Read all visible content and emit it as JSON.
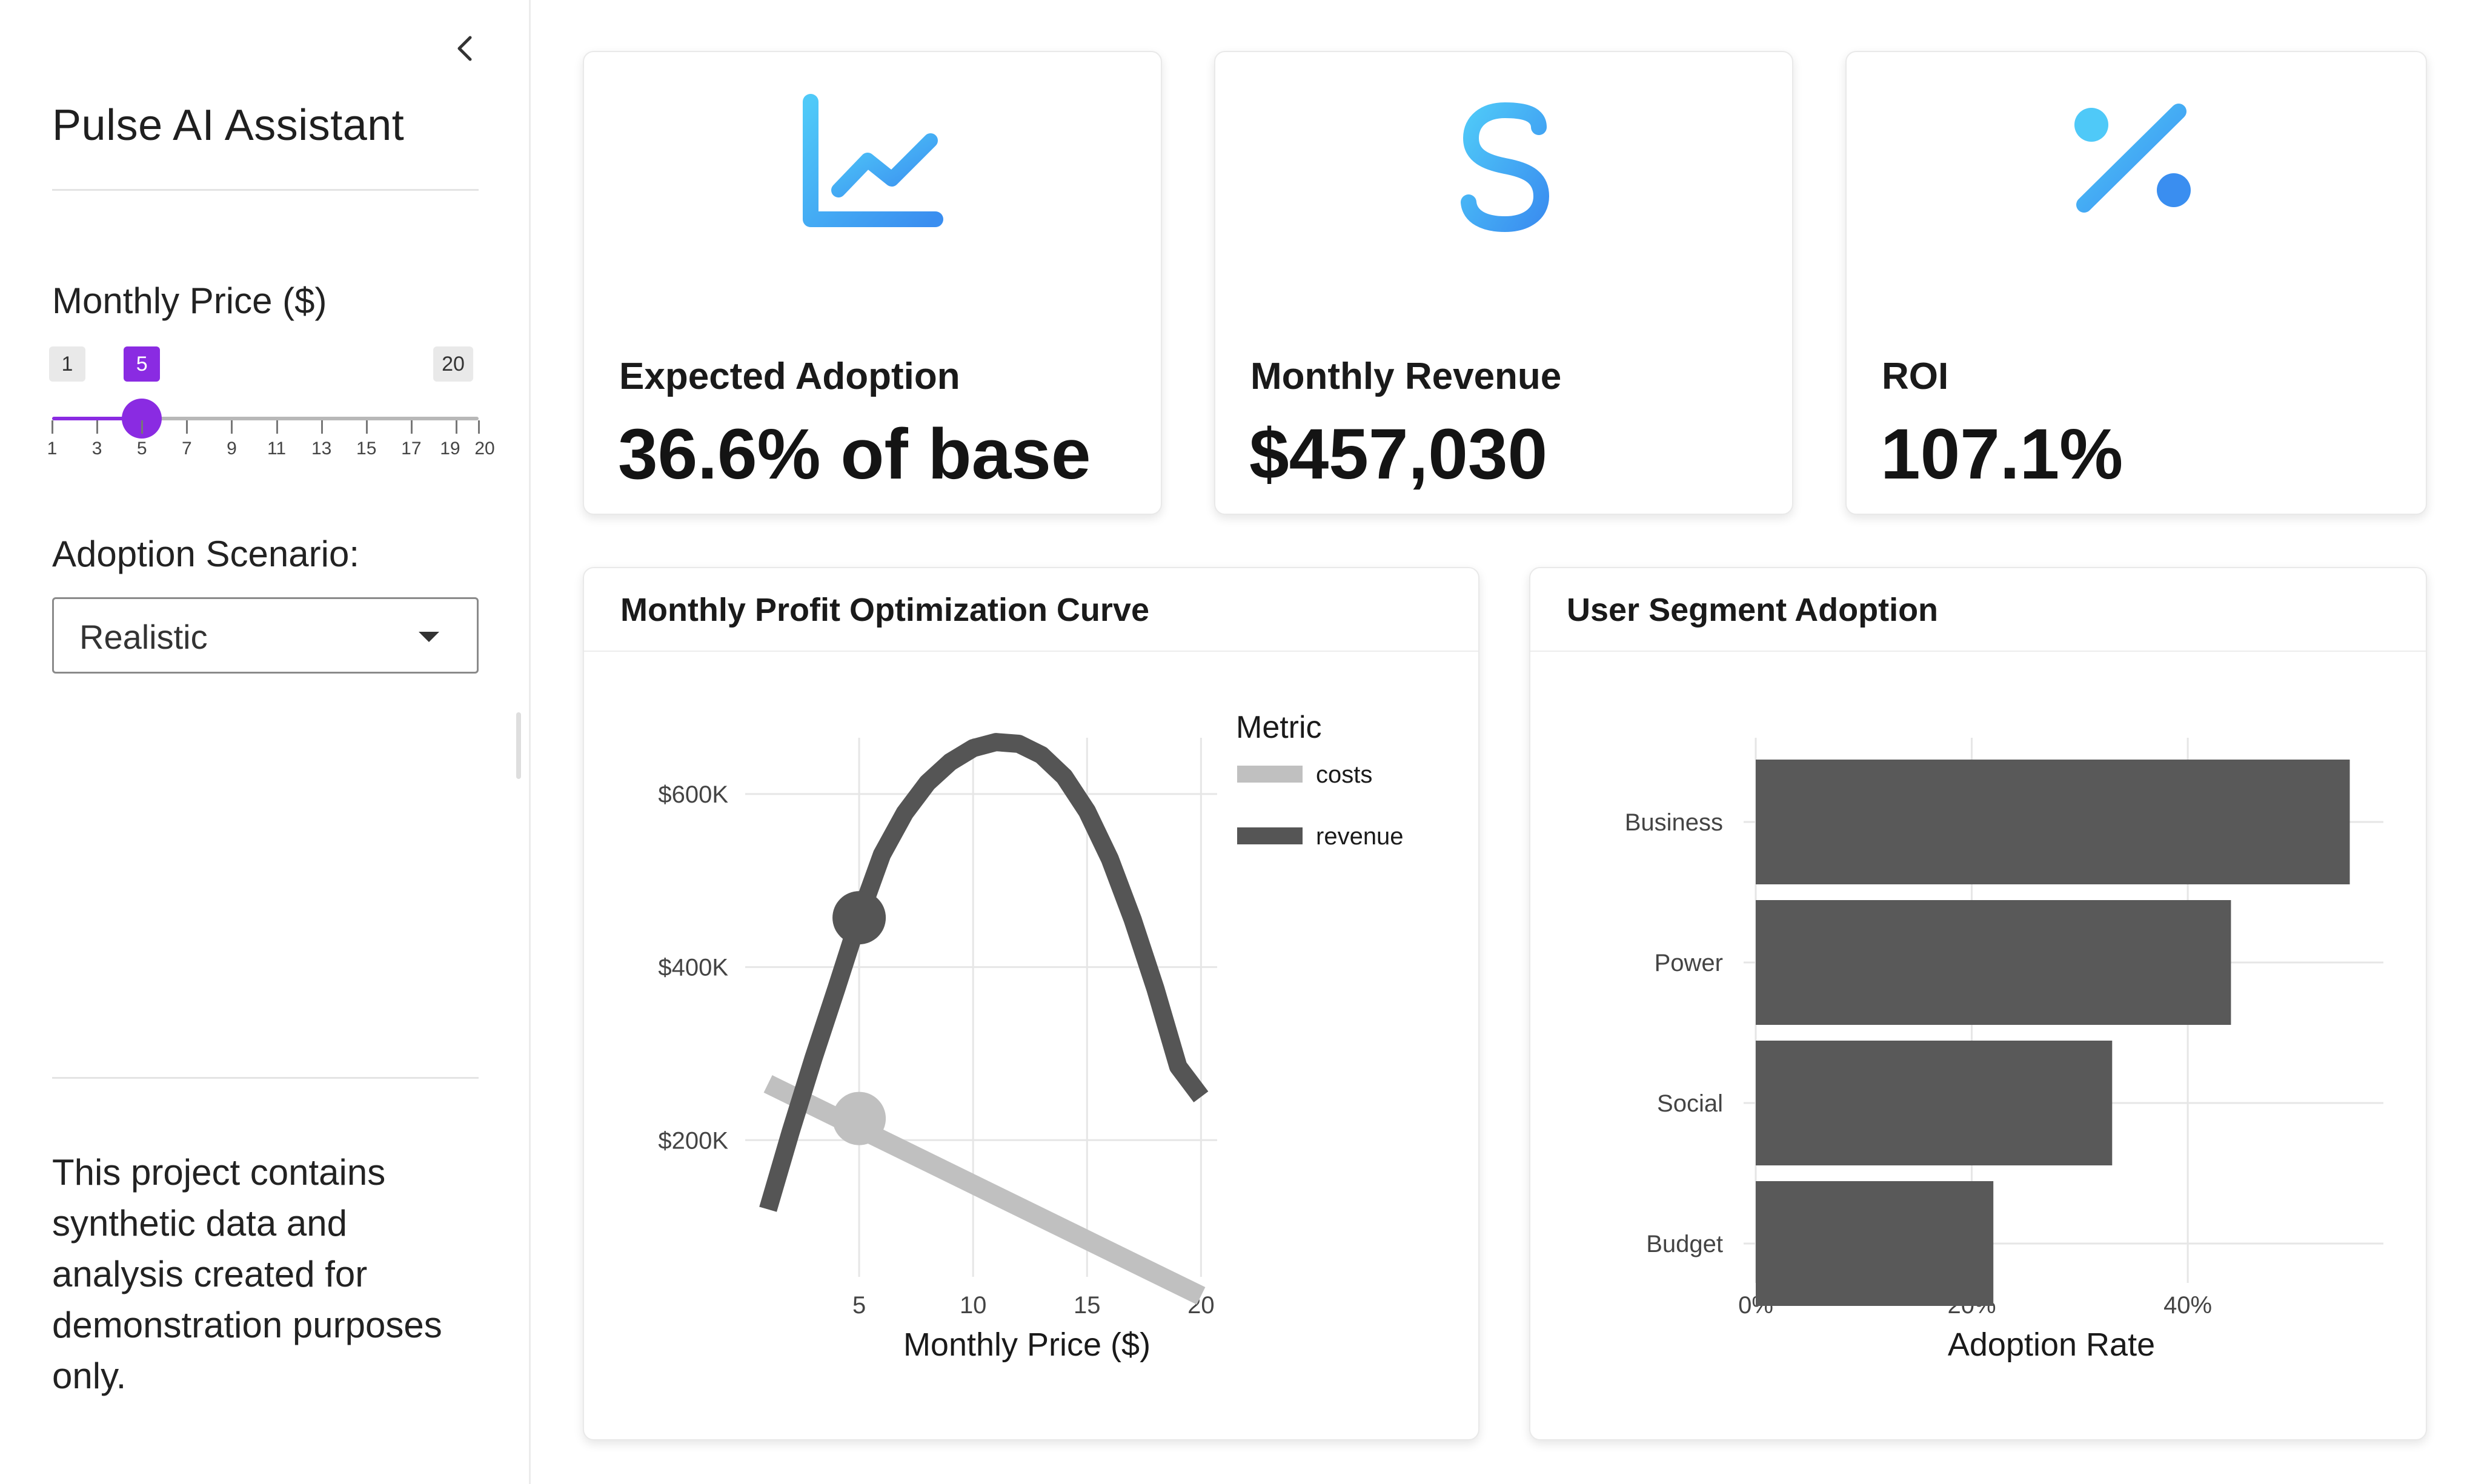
{
  "sidebar": {
    "title": "Pulse AI Assistant",
    "price_label": "Monthly Price ($)",
    "slider": {
      "min": 1,
      "max": 20,
      "value": 5,
      "min_label": "1",
      "max_label": "20",
      "value_label": "5",
      "ticks": [
        "1",
        "3",
        "5",
        "7",
        "9",
        "11",
        "13",
        "15",
        "17",
        "19",
        "20"
      ]
    },
    "scenario_label": "Adoption Scenario:",
    "scenario_value": "Realistic",
    "note": "This project contains synthetic data and analysis created for demonstration purposes only."
  },
  "kpis": [
    {
      "label": "Expected Adoption",
      "value": "36.6% of base",
      "icon": "line-chart-icon"
    },
    {
      "label": "Monthly Revenue",
      "value": "$457,030",
      "icon": "dollar-icon"
    },
    {
      "label": "ROI",
      "value": "107.1%",
      "icon": "percent-icon"
    }
  ],
  "colors": {
    "accent": "#8a2be2",
    "icon_gradient_start": "#4fc9f8",
    "icon_gradient_end": "#3a8ef0",
    "revenue_line": "#555555",
    "costs_line": "#c0c0c0",
    "bars": "#595959"
  },
  "chart_data": [
    {
      "type": "line",
      "title": "Monthly Profit Optimization Curve",
      "xlabel": "Monthly Price ($)",
      "ylabel": "",
      "xlim": [
        0,
        21
      ],
      "x_ticks": [
        5,
        10,
        15,
        20
      ],
      "x_tick_labels": [
        "5",
        "10",
        "15",
        "20"
      ],
      "y_ticks": [
        200000,
        400000,
        600000
      ],
      "y_tick_labels": [
        "$200K",
        "$400K",
        "$600K"
      ],
      "legend_title": "Metric",
      "legend_position": "right",
      "grid": true,
      "series": [
        {
          "name": "costs",
          "x": [
            1,
            20
          ],
          "values": [
            265000,
            20000
          ]
        },
        {
          "name": "revenue",
          "x": [
            1,
            2,
            3,
            4,
            5,
            6,
            7,
            8,
            9,
            10,
            11,
            12,
            13,
            14,
            15,
            16,
            17,
            18,
            19,
            20
          ],
          "values": [
            120000,
            210000,
            295000,
            375000,
            457030,
            530000,
            578000,
            613000,
            637000,
            653000,
            660000,
            658000,
            645000,
            620000,
            580000,
            525000,
            455000,
            375000,
            285000,
            250000
          ]
        }
      ],
      "markers": [
        {
          "series": "revenue",
          "x": 5,
          "y": 457030
        },
        {
          "series": "costs",
          "x": 5,
          "y": 225000
        }
      ]
    },
    {
      "type": "bar",
      "orientation": "horizontal",
      "title": "User Segment Adoption",
      "xlabel": "Adoption Rate",
      "ylabel": "",
      "categories": [
        "Business",
        "Power",
        "Social",
        "Budget"
      ],
      "values": [
        0.55,
        0.44,
        0.33,
        0.22
      ],
      "xlim": [
        0,
        0.58
      ],
      "x_ticks": [
        0,
        0.2,
        0.4
      ],
      "x_tick_labels": [
        "0%",
        "20%",
        "40%"
      ],
      "grid": true
    }
  ]
}
